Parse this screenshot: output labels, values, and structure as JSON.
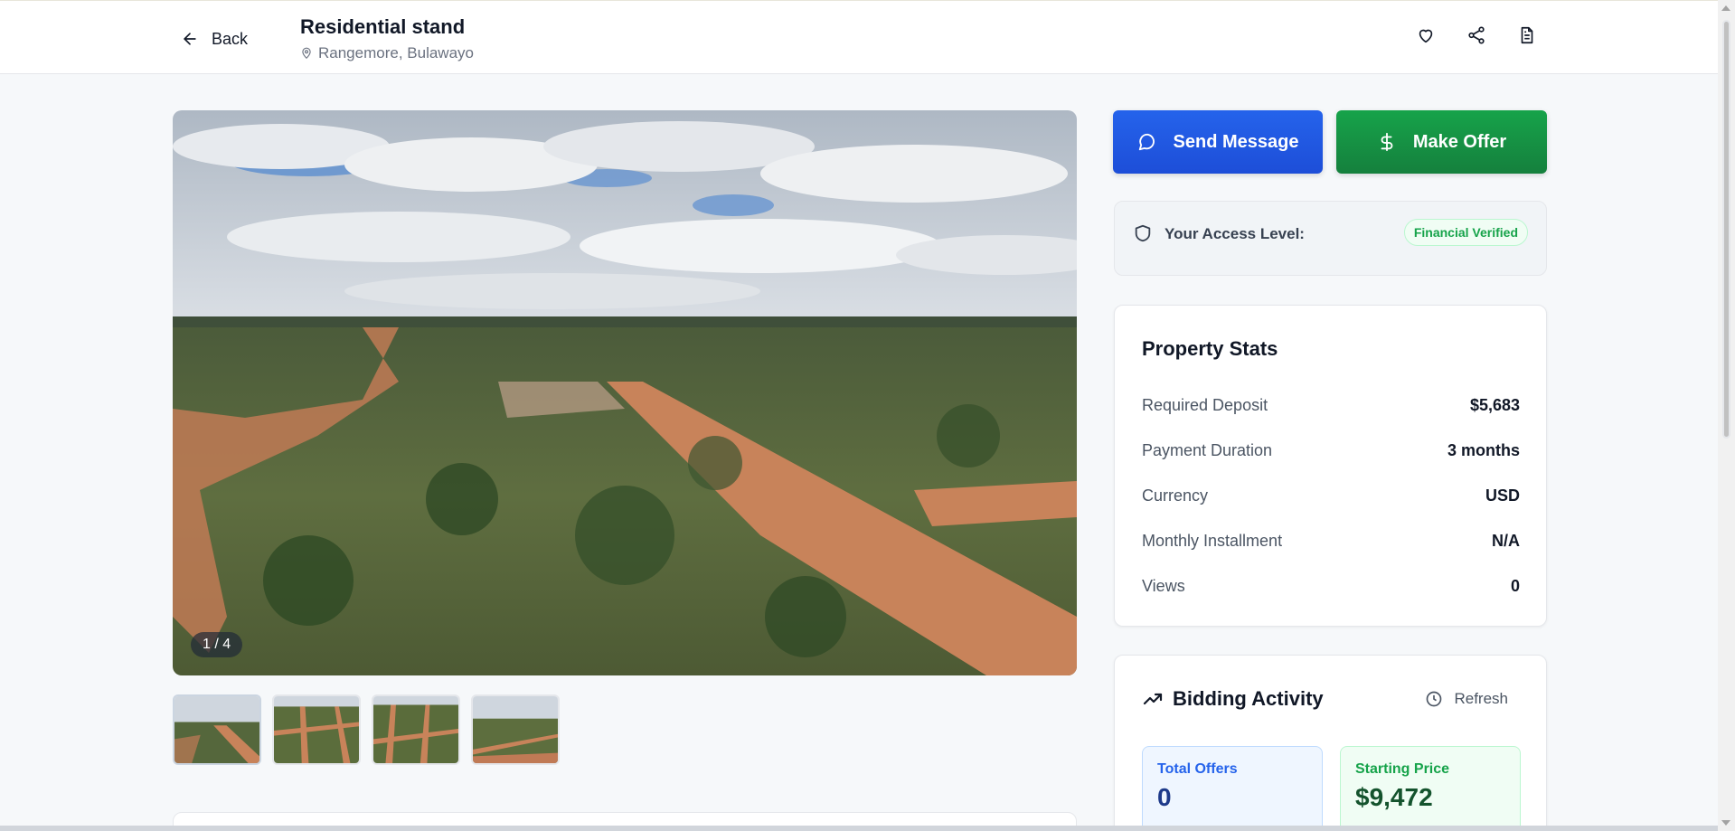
{
  "header": {
    "back_label": "Back",
    "title": "Residential stand",
    "location": "Rangemore, Bulawayo",
    "icons": [
      "heart-icon",
      "share-icon",
      "document-icon"
    ]
  },
  "gallery": {
    "counter": "1 / 4",
    "thumbnail_count": 4
  },
  "actions": {
    "send_message": "Send Message",
    "make_offer": "Make Offer"
  },
  "access": {
    "label": "Your Access Level:",
    "badge": "Financial Verified"
  },
  "stats": {
    "title": "Property Stats",
    "rows": [
      {
        "label": "Required Deposit",
        "value": "$5,683"
      },
      {
        "label": "Payment Duration",
        "value": "3 months"
      },
      {
        "label": "Currency",
        "value": "USD"
      },
      {
        "label": "Monthly Installment",
        "value": "N/A"
      },
      {
        "label": "Views",
        "value": "0"
      }
    ]
  },
  "bidding": {
    "title": "Bidding Activity",
    "refresh_label": "Refresh",
    "total_offers_label": "Total Offers",
    "total_offers_value": "0",
    "starting_price_label": "Starting Price",
    "starting_price_value": "$9,472"
  },
  "colors": {
    "primary_blue": "#1d4ed8",
    "primary_green": "#15803d",
    "badge_green": "#16a34a"
  }
}
